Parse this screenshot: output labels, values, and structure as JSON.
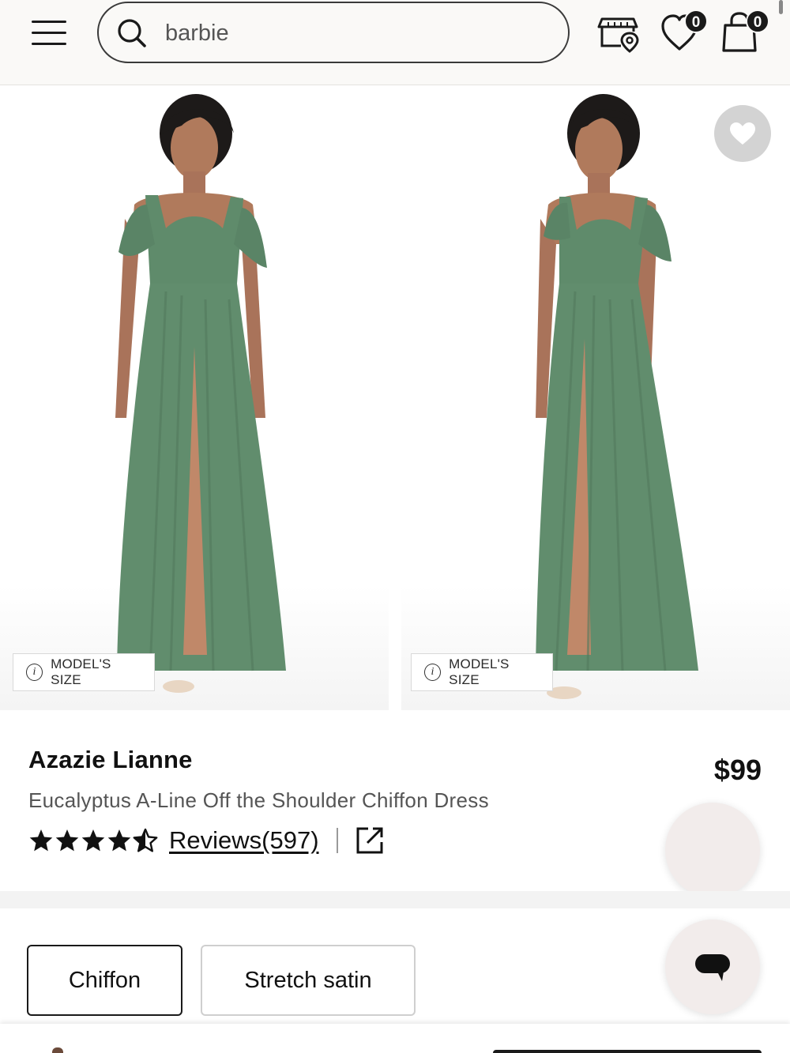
{
  "header": {
    "search_value": "barbie",
    "wishlist_count": "0",
    "bag_count": "0"
  },
  "gallery": {
    "model_size_label": "MODEL'S SIZE",
    "dress_color": "#5f8b6b"
  },
  "product": {
    "brand": "Azazie Lianne",
    "name": "Eucalyptus A-Line Off the Shoulder Chiffon Dress",
    "price": "$99",
    "rating": 4.5,
    "reviews_label": "Reviews(597)"
  },
  "fabric_options": [
    {
      "label": "Chiffon",
      "selected": true
    },
    {
      "label": "Stretch satin",
      "selected": false
    }
  ],
  "colors": {
    "accent": "#1a1a1a",
    "fab_background": "#f2eceb"
  }
}
